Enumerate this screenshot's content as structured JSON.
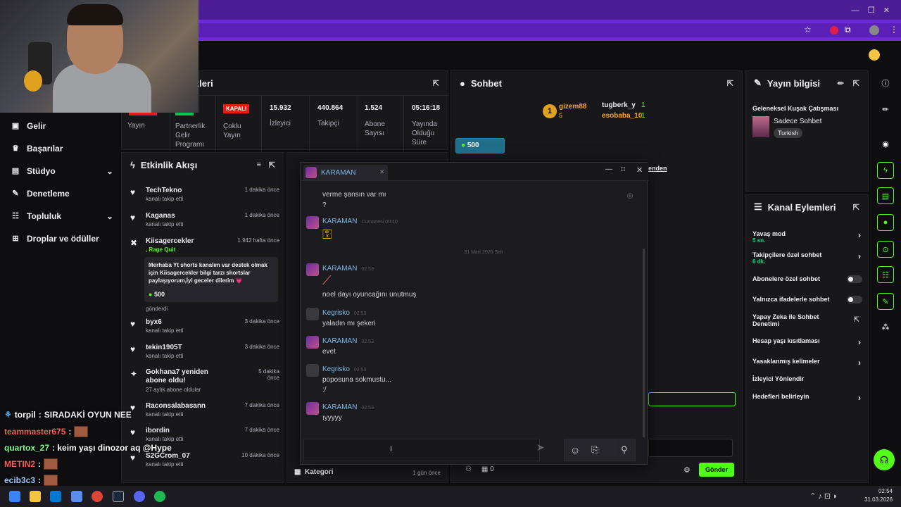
{
  "browser": {
    "bookmark_icon": "star-icon"
  },
  "stats": {
    "title": "tikleri",
    "yayin": "Yayın",
    "partner": "Partnerlik Gelir Programı",
    "kapali": "KAPALI",
    "coklu": "Çoklu Yayın",
    "izleyici_val": "15.932",
    "izleyici": "İzleyici",
    "takipci_val": "440.864",
    "takipci": "Takipçi",
    "abone_val": "1.524",
    "abone": "Abone Sayısı",
    "sure_val": "05:16:18",
    "sure": "Yayında Olduğu Süre"
  },
  "nav": {
    "items": [
      "Gelir",
      "Başarılar",
      "Stüdyo",
      "Denetleme",
      "Topluluk",
      "Droplar ve ödüller"
    ]
  },
  "feed": {
    "title": "Etkinlik Akışı",
    "items": [
      {
        "name": "TechTekno",
        "sub": "kanalı takip etti",
        "time": "1 dakika önce"
      },
      {
        "name": "Kaganas",
        "sub": "kanalı takip etti",
        "time": "1 dakika önce"
      },
      {
        "name": "Kiisagercekler",
        "sub": ", Rage Quit",
        "time": "1.942 hafta önce"
      },
      {
        "name": "byx6",
        "sub": "kanalı takip etti",
        "time": "3 dakika önce"
      },
      {
        "name": "tekin1905T",
        "sub": "kanalı takip etti",
        "time": "3 dakika önce"
      },
      {
        "name": "Gokhana7 yeniden abone oldu!",
        "sub": "27 aylık abone oldular",
        "time": "5 dakika önce"
      },
      {
        "name": "Raconsalabasann",
        "sub": "kanalı takip etti",
        "time": "7 dakika önce"
      },
      {
        "name": "ibordin",
        "sub": "kanalı takip etti",
        "time": "7 dakika önce"
      },
      {
        "name": "S2GCrom_07",
        "sub": "kanalı takip etti",
        "time": "10 dakika önce"
      }
    ],
    "donation_msg": "Merhaba Yt shorts kanalım var destek olmak için Kiisagercekler bilgi tarzı shortslar paylaşıyorum,İyi geceler dilerim 💗",
    "donation_amt": "500",
    "donation_sent": "gönderdi"
  },
  "sohbet": {
    "title": "Sohbet",
    "top1": "gizem88",
    "top1_n": "5",
    "top2": "tugberk_y",
    "top2_n": "1",
    "top3": "esobaba_10",
    "top3_n": "1",
    "rank": "1",
    "bits": "500",
    "sender_btn": "Gönder",
    "kategori": "Kategori",
    "kategori_time": "1 gün önce",
    "viewer_n": "0",
    "pin_label": "enden"
  },
  "yayin": {
    "title": "Yayın bilgisi",
    "stream_title": "Geleneksel Kuşak Çatışması",
    "category": "Sadece Sohbet",
    "tag": "Turkish"
  },
  "kanal": {
    "title": "Kanal Eylemleri",
    "rows": [
      {
        "label": "Yavaş mod",
        "sub": "5 sn."
      },
      {
        "label": "Takipçilere özel sohbet",
        "sub": "6 dk."
      },
      {
        "label": "Abonelere özel sohbet",
        "sub": ""
      },
      {
        "label": "Yalnızca ifadelerle sohbet",
        "sub": ""
      },
      {
        "label": "Yapay Zeka ile Sohbet Denetimi",
        "sub": ""
      },
      {
        "label": "Hesap yaşı kısıtlaması",
        "sub": ""
      },
      {
        "label": "Yasaklanmış kelimeler",
        "sub": ""
      },
      {
        "label": "İzleyici Yönlendir",
        "sub": ""
      },
      {
        "label": "Hedefleri belirleyin",
        "sub": ""
      }
    ]
  },
  "dm": {
    "title": "KARAMAN",
    "messages": [
      {
        "text1": "verme şansın var mı",
        "text2": "?"
      },
      {
        "who": "KARAMAN",
        "when": "Cumartesi 00:40"
      },
      {
        "divider": "31 Mart 2026 Salı"
      },
      {
        "who": "KARAMAN",
        "when": "02:53",
        "text": "noel dayı oyuncağını unutmuş"
      },
      {
        "who": "Kegrisko",
        "when": "02:53",
        "text": "yaladın mı şekeri"
      },
      {
        "who": "KARAMAN",
        "when": "02:53",
        "text": "evet"
      },
      {
        "who": "Kegrisko",
        "when": "02:53",
        "text": "poposuna sokmustu...",
        "text2": ":/"
      },
      {
        "who": "KARAMAN",
        "when": "02:53",
        "text": "ıyyyyy"
      }
    ]
  },
  "overlay": [
    {
      "name": "torpil",
      "text": "SIRADAKİ OYUN NEE",
      "color": "#efeff1"
    },
    {
      "name": "teammaster675",
      "text": ":",
      "color": "#ff5a5a"
    },
    {
      "name": "quartox_27",
      "text": ": keim yaşı dinozor aq @Hype",
      "color": "#efeff1"
    },
    {
      "name": "METIN2",
      "text": ":",
      "color": "#ff5a5a"
    },
    {
      "name": "ecib3c3",
      "text": ":",
      "color": "#efeff1"
    }
  ],
  "taskbar": {
    "time": "02:54",
    "date": "31.03.2026"
  }
}
